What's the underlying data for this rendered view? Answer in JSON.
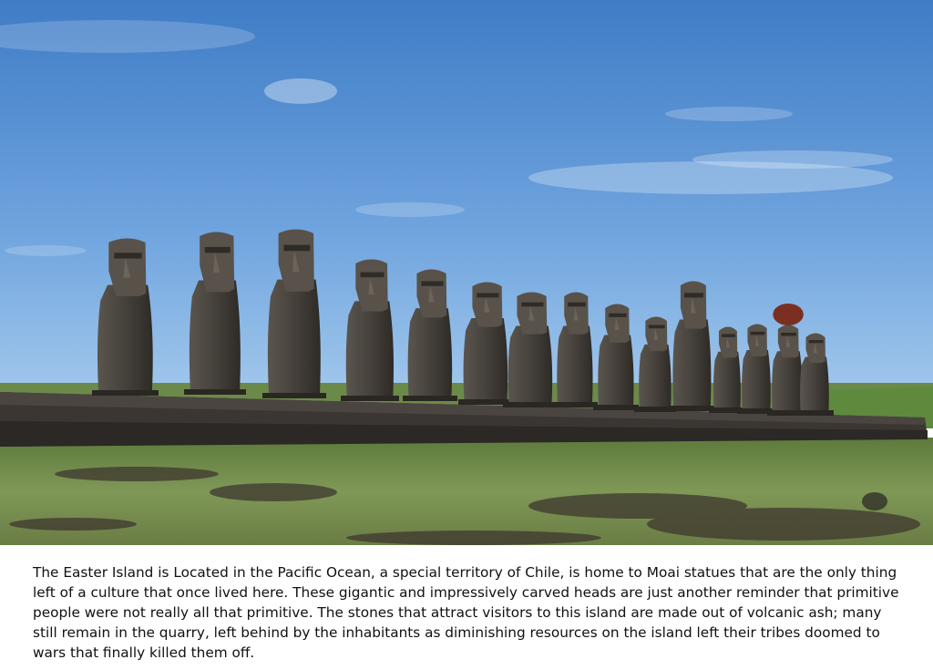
{
  "photo": {
    "subject": "moai-statues-row",
    "statue_count": 15,
    "colors": {
      "sky_top": "#4a86cc",
      "sky_bottom": "#9cc4ec",
      "platform": "#3a3632",
      "statue": "#4a4540",
      "grass": "#6f8a4a",
      "topknot": "#7a2f22"
    }
  },
  "caption": {
    "text": "The Easter Island is Located in the Pacific Ocean, a special territory of Chile, is home to Moai statues that are the only thing left of a culture that once lived here. These gigantic and impressively carved heads are just another reminder that primitive people were not really all that primitive. The stones that attract visitors to this island are made out of volcanic ash; many still remain in the quarry, left behind by the inhabitants as diminishing resources on the island left their tribes doomed to wars that finally killed them off."
  }
}
